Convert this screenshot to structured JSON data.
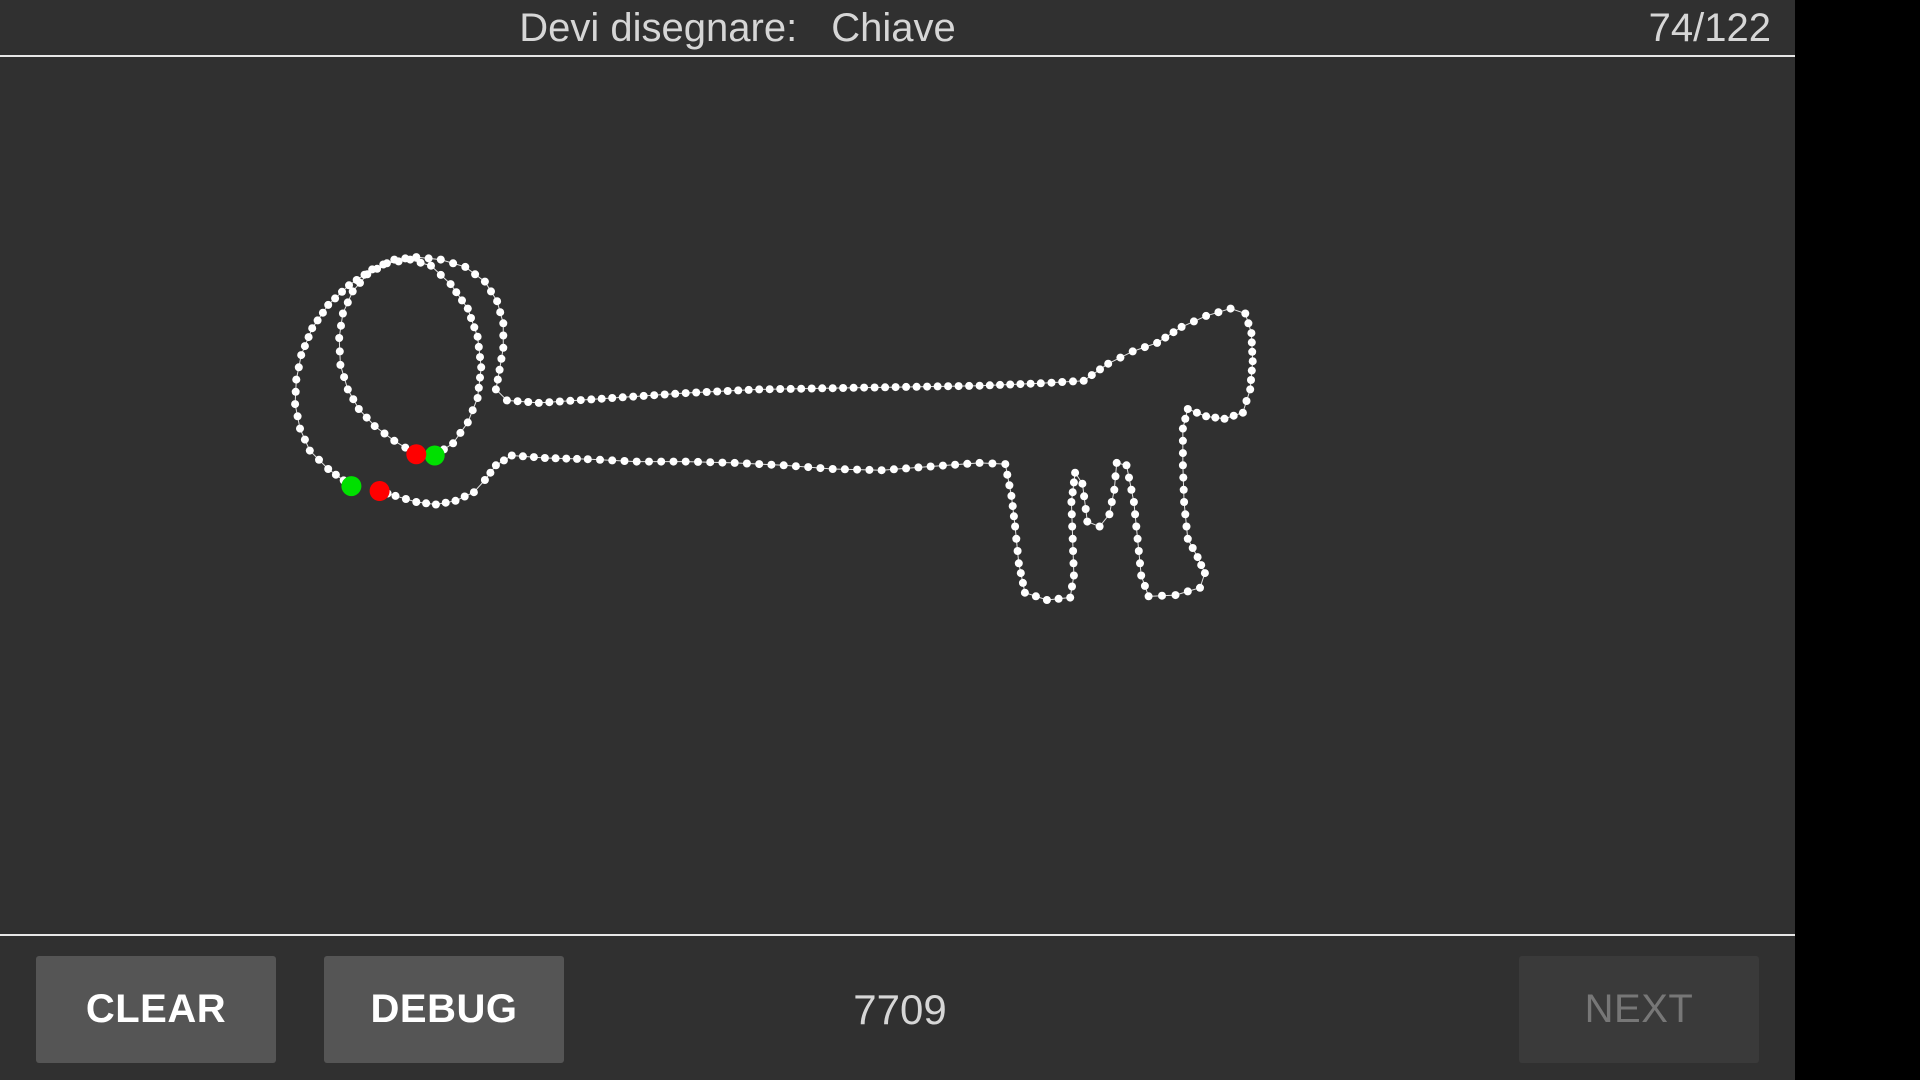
{
  "header": {
    "prompt_label": "Devi disegnare:",
    "target_word": "Chiave",
    "progress": "74/122"
  },
  "footer": {
    "clear_label": "CLEAR",
    "debug_label": "DEBUG",
    "score": "7709",
    "next_label": "NEXT",
    "next_enabled": false
  },
  "colors": {
    "background": "#303030",
    "stroke_points": "#ffffff",
    "stroke_start": "#00e000",
    "stroke_end": "#ff0000",
    "divider": "#e6e6e6"
  }
}
